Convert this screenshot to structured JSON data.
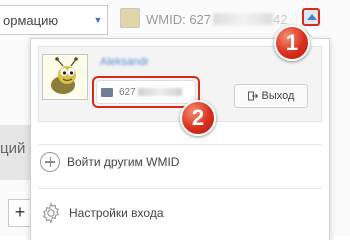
{
  "page": {
    "select_value": "ормацию",
    "side_text": "ций",
    "plus_label": "+"
  },
  "header": {
    "wmid_label": "WMID: 627",
    "wmid_tail": "42"
  },
  "account": {
    "name": "Aleksandr",
    "wallet_prefix": "627",
    "logout_label": "Выход"
  },
  "menu": {
    "login_other": "Войти другим WMID",
    "login_settings": "Настройки входа"
  },
  "callouts": [
    "1",
    "2"
  ],
  "colors": {
    "accent": "#3a79c0",
    "callout": "#d9301d",
    "link": "#5a8cd6"
  }
}
